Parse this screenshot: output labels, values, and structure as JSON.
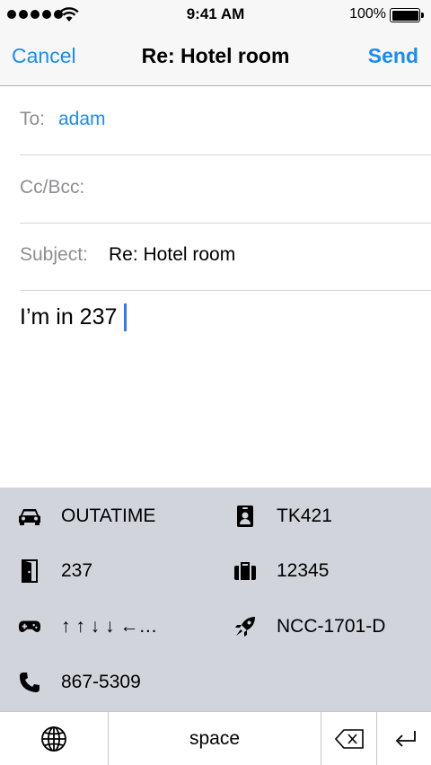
{
  "status_bar": {
    "time": "9:41 AM",
    "battery_pct": "100%"
  },
  "nav": {
    "cancel": "Cancel",
    "title": "Re: Hotel room",
    "send": "Send"
  },
  "fields": {
    "to_label": "To:",
    "to_value": "adam",
    "ccbcc_label": "Cc/Bcc:",
    "subject_label": "Subject:",
    "subject_value": "Re: Hotel room"
  },
  "body": {
    "text": "I’m in 237"
  },
  "suggestions": [
    {
      "icon": "car-icon",
      "text": "OUTATIME"
    },
    {
      "icon": "id-badge-icon",
      "text": "TK421"
    },
    {
      "icon": "door-icon",
      "text": "237"
    },
    {
      "icon": "luggage-icon",
      "text": "12345"
    },
    {
      "icon": "gamepad-icon",
      "text": "↑ ↑ ↓ ↓ ←…"
    },
    {
      "icon": "rocket-icon",
      "text": "NCC-1701-D"
    },
    {
      "icon": "phone-icon",
      "text": "867-5309"
    }
  ],
  "keyboard": {
    "space": "space"
  },
  "colors": {
    "accent": "#1a8cf0",
    "caret": "#3478f6",
    "panel_bg": "#d1d4da"
  }
}
